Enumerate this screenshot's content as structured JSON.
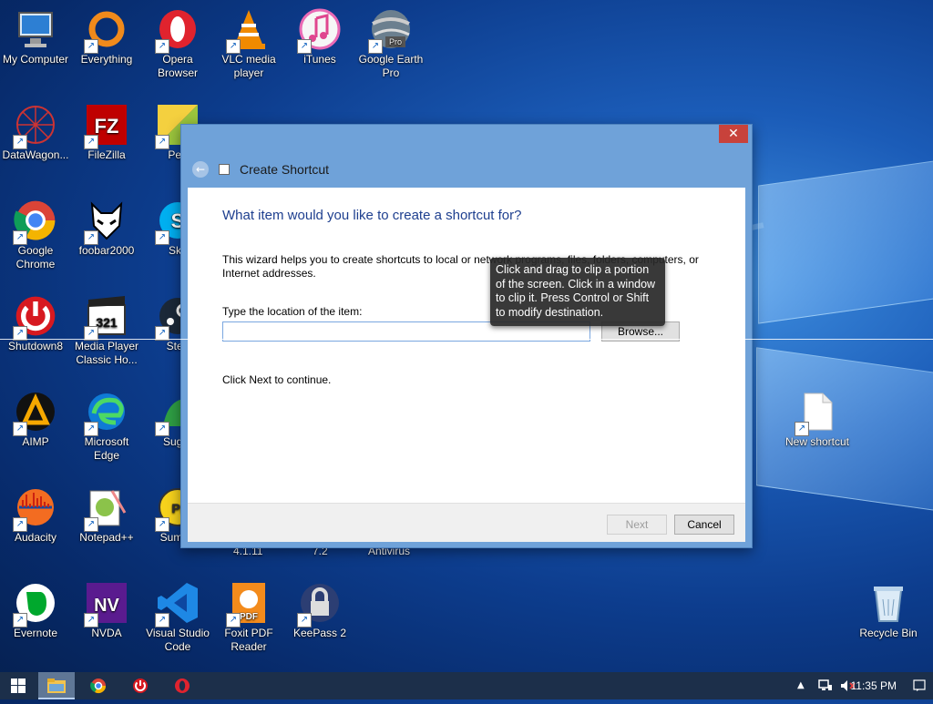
{
  "desktop": {
    "icons": [
      {
        "label": "My Computer",
        "icon": "computer-icon"
      },
      {
        "label": "Everything",
        "icon": "everything-icon"
      },
      {
        "label": "Opera Browser",
        "icon": "opera-icon"
      },
      {
        "label": "VLC media player",
        "icon": "vlc-icon"
      },
      {
        "label": "iTunes",
        "icon": "itunes-icon"
      },
      {
        "label": "Google Earth Pro",
        "icon": "google-earth-icon",
        "badge": "Pro"
      },
      {
        "label": "DataWagon...",
        "icon": "datawagon-icon"
      },
      {
        "label": "FileZilla",
        "icon": "filezilla-icon",
        "glyph": "FZ"
      },
      {
        "label": "Pea",
        "icon": "peazip-icon"
      },
      {
        "label": "Google Chrome",
        "icon": "chrome-icon"
      },
      {
        "label": "foobar2000",
        "icon": "foobar-icon"
      },
      {
        "label": "Sky",
        "icon": "skype-icon",
        "glyph": "S"
      },
      {
        "label": "Shutdown8",
        "icon": "shutdown-icon"
      },
      {
        "label": "Media Player Classic Ho...",
        "icon": "mpc-icon",
        "glyph": "321"
      },
      {
        "label": "Stea",
        "icon": "steam-icon"
      },
      {
        "label": "AIMP",
        "icon": "aimp-icon"
      },
      {
        "label": "Microsoft Edge",
        "icon": "edge-icon"
      },
      {
        "label": "Sugar",
        "icon": "sugarsync-icon"
      },
      {
        "label": "Audacity",
        "icon": "audacity-icon"
      },
      {
        "label": "Notepad++",
        "icon": "notepadpp-icon"
      },
      {
        "label": "Sumatr",
        "icon": "sumatra-icon",
        "glyph": "PI"
      },
      {
        "label": "Evernote",
        "icon": "evernote-icon"
      },
      {
        "label": "NVDA",
        "icon": "nvda-icon",
        "glyph": "NV"
      },
      {
        "label": "Visual Studio Code",
        "icon": "vscode-icon"
      },
      {
        "label": "Foxit PDF Reader",
        "icon": "foxit-icon",
        "glyph": "PDF"
      },
      {
        "label": "KeePass 2",
        "icon": "keepass-icon"
      },
      {
        "label": "New shortcut",
        "icon": "file-icon"
      },
      {
        "label": "Recycle Bin",
        "icon": "recycle-bin-icon"
      }
    ],
    "partial_labels": [
      "4.1.11",
      "7.2",
      "Antivirus"
    ]
  },
  "dialog": {
    "title": "Create Shortcut",
    "close_label": "✕",
    "heading": "What item would you like to create a shortcut for?",
    "description": "This wizard helps you to create shortcuts to local or network programs, files, folders, computers, or Internet addresses.",
    "location_label": "Type the location of the item:",
    "location_value": "",
    "browse_label": "Browse...",
    "continue_text": "Click Next to continue.",
    "next_label": "Next",
    "cancel_label": "Cancel"
  },
  "tooltip": {
    "text": "Click and drag to clip a portion of the screen. Click in a window to clip it. Press Control or Shift to modify destination."
  },
  "taskbar": {
    "items": [
      "start-icon",
      "file-explorer-icon",
      "chrome-icon",
      "shutdown-icon",
      "opera-icon"
    ],
    "clock": "11:35 PM"
  },
  "colors": {
    "heading": "#1e3f8f",
    "close": "#c8423b",
    "taskbar": "#1c2f4a"
  }
}
